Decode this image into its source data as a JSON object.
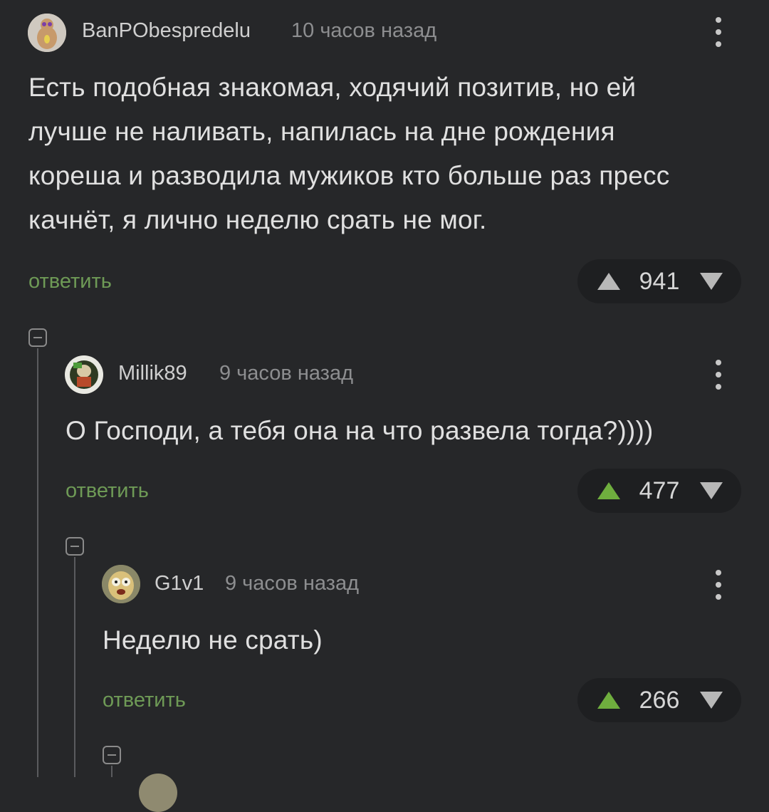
{
  "comments": [
    {
      "username": "BanPObespredelu",
      "time": "10 часов назад",
      "text": "Есть подобная знакомая, ходячий позитив, но ей лучше не наливать, напилась на дне рождения кореша и разводила мужиков кто больше раз пресс качнёт, я лично неделю срать не мог.",
      "reply_label": "ответить",
      "rating": "941",
      "upvoted": false
    },
    {
      "username": "Millik89",
      "time": "9 часов назад",
      "text": "О Господи, а тебя она на что развела тогда?))))",
      "reply_label": "ответить",
      "rating": "477",
      "upvoted": true
    },
    {
      "username": "G1v1",
      "time": "9 часов назад",
      "text": "Неделю не срать)",
      "reply_label": "ответить",
      "rating": "266",
      "upvoted": true
    }
  ],
  "colors": {
    "background": "#262729",
    "reply_link": "#6e9a56",
    "upvote_active": "#6fae3e",
    "vote_inactive": "#b8b8b8"
  },
  "icons": [
    "avatar",
    "more-options-icon",
    "upvote-icon",
    "downvote-icon",
    "collapse-thread-icon"
  ]
}
